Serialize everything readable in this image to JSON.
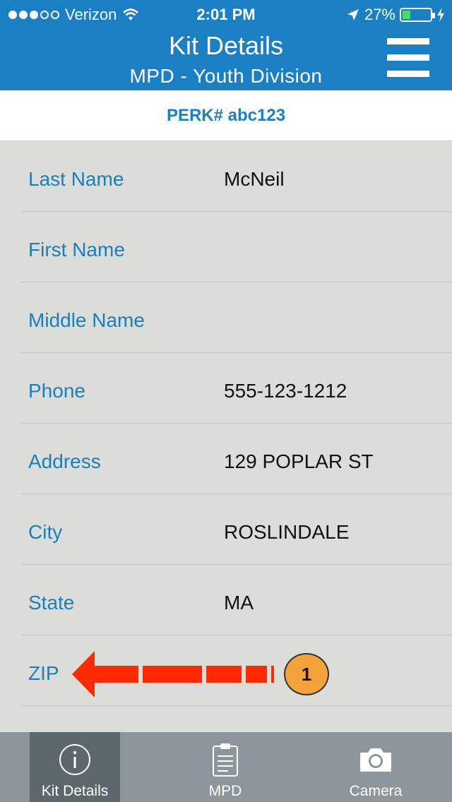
{
  "status": {
    "carrier": "Verizon",
    "time": "2:01 PM",
    "battery": "27%",
    "battery_level": 0.27
  },
  "header": {
    "title": "Kit Details",
    "subtitle": "MPD - Youth Division"
  },
  "perk": {
    "text": "PERK# abc123"
  },
  "fields": [
    {
      "label": "Last Name",
      "value": "McNeil"
    },
    {
      "label": "First Name",
      "value": ""
    },
    {
      "label": "Middle Name",
      "value": ""
    },
    {
      "label": "Phone",
      "value": "555-123-1212"
    },
    {
      "label": "Address",
      "value": "129 POPLAR ST"
    },
    {
      "label": "City",
      "value": "ROSLINDALE"
    },
    {
      "label": "State",
      "value": "MA"
    },
    {
      "label": "ZIP",
      "value": ""
    }
  ],
  "annotation": {
    "badge": "1",
    "arrow_color": "#ff2a00",
    "badge_color": "#f4a23a"
  },
  "tabs": [
    {
      "label": "Kit Details",
      "icon": "info-icon",
      "active": true
    },
    {
      "label": "MPD",
      "icon": "clipboard-icon",
      "active": false
    },
    {
      "label": "Camera",
      "icon": "camera-icon",
      "active": false
    }
  ],
  "colors": {
    "brand": "#1b7fc4",
    "label": "#1a7fc0",
    "tabbar": "#8c969c",
    "tab_active": "#5d686e"
  }
}
